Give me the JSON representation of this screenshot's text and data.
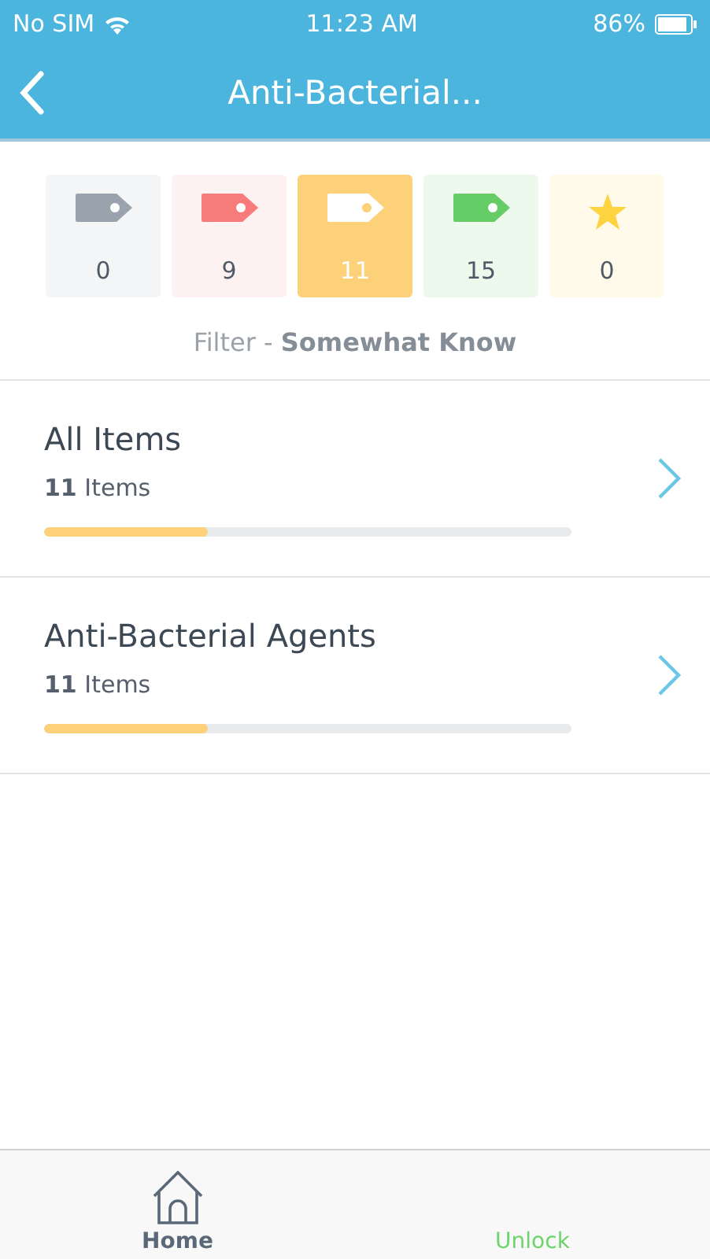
{
  "status_bar": {
    "carrier": "No SIM",
    "time": "11:23 AM",
    "battery": "86%"
  },
  "nav": {
    "title": "Anti-Bacterial..."
  },
  "filters": [
    {
      "kind": "tag",
      "color": "#9aa3ad",
      "count": "0",
      "selected": false
    },
    {
      "kind": "tag",
      "color": "#f77b7b",
      "count": "9",
      "selected": false
    },
    {
      "kind": "tag",
      "color": "#fdd07a",
      "count": "11",
      "selected": true
    },
    {
      "kind": "tag",
      "color": "#66cc66",
      "count": "15",
      "selected": false
    },
    {
      "kind": "star",
      "color": "#fdd33f",
      "count": "0",
      "selected": false
    }
  ],
  "filter_label": "Filter - **Somewhat Know**",
  "decks": [
    {
      "title": "All Items",
      "count": "11",
      "unit": "Items",
      "level": 0.31
    },
    {
      "title": "Anti-Bacterial Agents",
      "count": "11",
      "unit": "Items",
      "level": 0.31
    }
  ],
  "tab_bar": [
    {
      "kind": "home",
      "label": "Home",
      "selected": true
    },
    {
      "kind": "unlock",
      "label": "Unlock",
      "selected": false
    }
  ]
}
